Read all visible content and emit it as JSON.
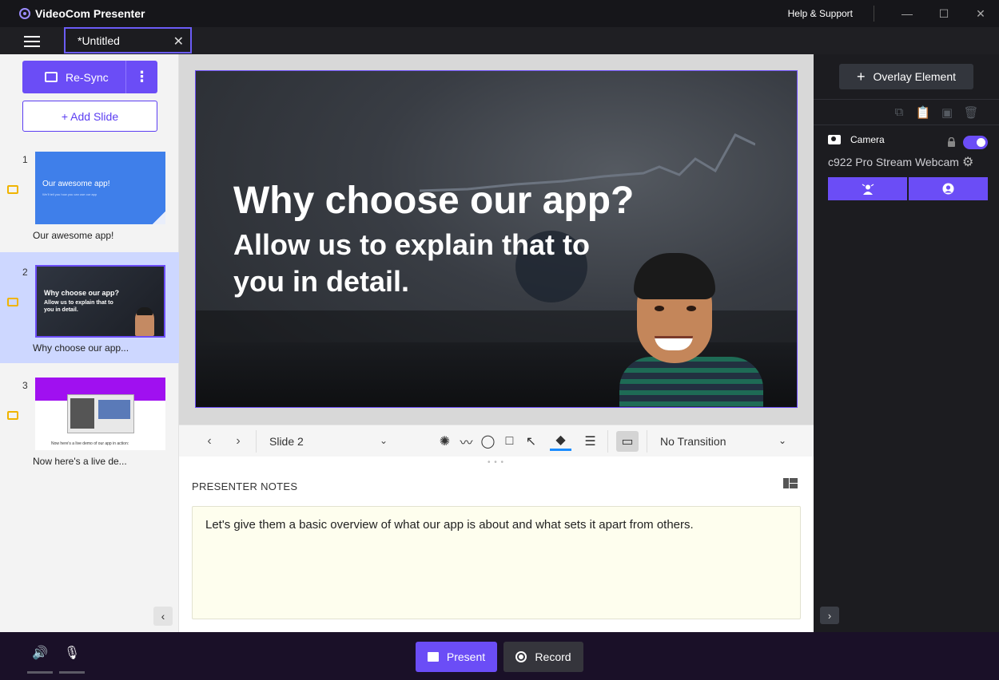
{
  "app": {
    "title": "VideoCom Presenter",
    "help_label": "Help & Support"
  },
  "window_controls": {
    "minimize": "—",
    "maximize": "☐",
    "close": "✕"
  },
  "tab": {
    "title": "*Untitled",
    "close": "✕"
  },
  "left_panel": {
    "resync_label": "Re-Sync",
    "more_label": "⋮",
    "add_slide_label": "+ Add Slide",
    "collapse": "‹",
    "slides": [
      {
        "number": "1",
        "caption": "Our awesome app!",
        "thumb_title": "Our awesome app!",
        "thumb_sub": "We'll tell you how you can use our app"
      },
      {
        "number": "2",
        "caption": "Why choose our app...",
        "thumb_title": "Why choose our app?",
        "thumb_sub": "Allow us to explain that to you in detail."
      },
      {
        "number": "3",
        "caption": "Now here's a live de...",
        "thumb_sub": "Now here's a live demo of our app in action:"
      }
    ],
    "selected_index": 2
  },
  "stage": {
    "headline": "Why choose our app?",
    "subline": "Allow us to explain that to you in detail."
  },
  "toolbar": {
    "prev": "‹",
    "next": "›",
    "slide_select": "Slide 2",
    "chevron": "⌄",
    "tools": [
      "spotlight-icon",
      "laser-icon",
      "ellipse-icon",
      "rectangle-icon",
      "arrow-icon",
      "fill-icon",
      "line-width-icon",
      "notes-toggle-icon"
    ],
    "transition_select": "No Transition",
    "accent_color": "#1a8cff"
  },
  "notes": {
    "title": "PRESENTER NOTES",
    "text": "Let's give them a basic overview of what our app is about and what sets it apart from others."
  },
  "right_panel": {
    "overlay_label": "Overlay Element",
    "camera_label": "Camera",
    "camera_enabled": true,
    "webcam_name": "c922 Pro Stream Webcam",
    "expand": "›"
  },
  "bottom": {
    "present_label": "Present",
    "record_label": "Record"
  },
  "colors": {
    "accent": "#6b4df6",
    "dark": "#1c1c20",
    "notes_bg": "#fefeee"
  }
}
